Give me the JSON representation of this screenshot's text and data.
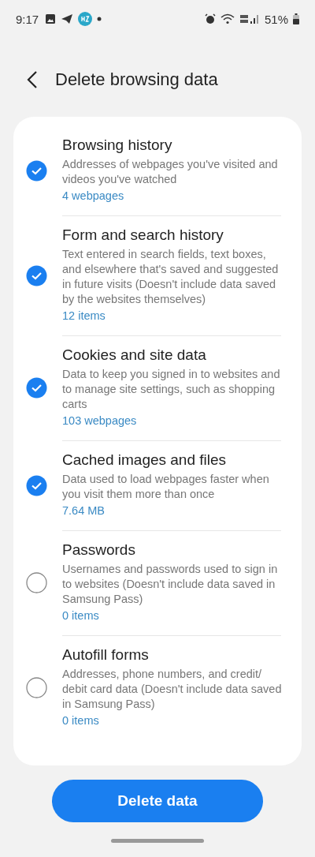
{
  "status_bar": {
    "time": "9:17",
    "battery": "51%"
  },
  "header": {
    "title": "Delete browsing data"
  },
  "items": [
    {
      "title": "Browsing history",
      "description": "Addresses of webpages you've visited and videos you've watched",
      "count": "4 webpages",
      "checked": true
    },
    {
      "title": "Form and search history",
      "description": "Text entered in search fields, text boxes, and elsewhere that's saved and suggested in future visits (Doesn't include data saved by the websites themselves)",
      "count": "12 items",
      "checked": true
    },
    {
      "title": "Cookies and site data",
      "description": "Data to keep you signed in to websites and to manage site settings, such as shopping carts",
      "count": "103 webpages",
      "checked": true
    },
    {
      "title": "Cached images and files",
      "description": "Data used to load webpages faster when you visit them more than once",
      "count": "7.64 MB",
      "checked": true
    },
    {
      "title": "Passwords",
      "description": "Usernames and passwords used to sign in to websites (Doesn't include data saved in Samsung Pass)",
      "count": "0 items",
      "checked": false
    },
    {
      "title": "Autofill forms",
      "description": "Addresses, phone numbers, and credit/ debit card data (Doesn't include data saved in Samsung Pass)",
      "count": "0 items",
      "checked": false
    }
  ],
  "delete_button": {
    "label": "Delete data"
  }
}
